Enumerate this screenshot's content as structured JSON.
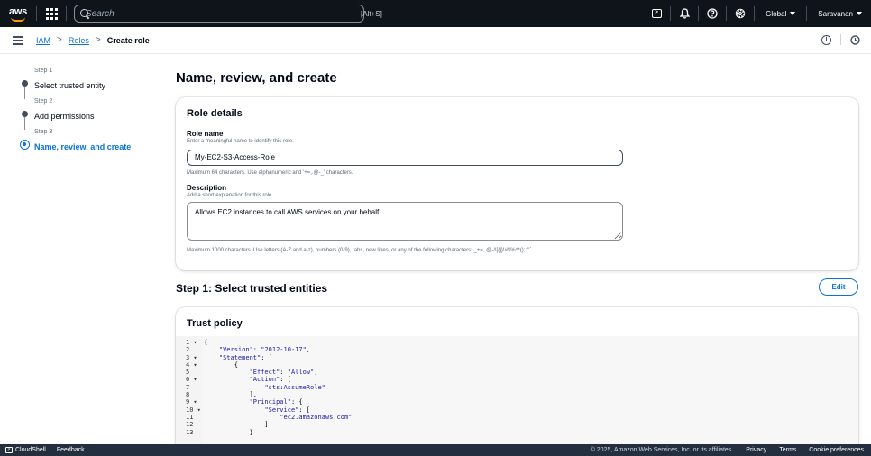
{
  "topbar": {
    "logo_text": "aws",
    "search_placeholder": "Search",
    "search_shortcut": "[Alt+S]",
    "region_label": "Global",
    "user_label": "Saravanan"
  },
  "breadcrumb": {
    "items": [
      "IAM",
      "Roles"
    ],
    "current": "Create role"
  },
  "steps": [
    {
      "step": "Step 1",
      "name": "Select trusted entity",
      "state": "complete"
    },
    {
      "step": "Step 2",
      "name": "Add permissions",
      "state": "complete"
    },
    {
      "step": "Step 3",
      "name": "Name, review, and create",
      "state": "active"
    }
  ],
  "main": {
    "title": "Name, review, and create",
    "role_details": {
      "header": "Role details",
      "role_name_label": "Role name",
      "role_name_description": "Enter a meaningful name to identify this role.",
      "role_name_value": "My-EC2-S3-Access-Role",
      "role_name_constraint": "Maximum 64 characters. Use alphanumeric and '+=,.@-_' characters.",
      "description_label": "Description",
      "description_description": "Add a short explanation for this role.",
      "description_value": "Allows EC2 instances to call AWS services on your behalf.",
      "description_constraint": "Maximum 1000 characters. Use letters (A-Z and a-z), numbers (0-9), tabs, new lines, or any of the following characters: _+=,.@-/\\[{]}!#$%^*();:\"'`"
    },
    "step1": {
      "title": "Step 1: Select trusted entities",
      "edit_label": "Edit",
      "trust_policy_header": "Trust policy",
      "line_numbers": [
        "1 ▾",
        "2",
        "3 ▾",
        "4 ▾",
        "5",
        "6 ▾",
        "7",
        "8",
        "9 ▾",
        "10 ▾",
        "11",
        "12",
        "13"
      ],
      "code_lines": [
        "{",
        "    \"Version\": \"2012-10-17\",",
        "    \"Statement\": [",
        "        {",
        "            \"Effect\": \"Allow\",",
        "            \"Action\": [",
        "                \"sts:AssumeRole\"",
        "            ],",
        "            \"Principal\": {",
        "                \"Service\": [",
        "                    \"ec2.amazonaws.com\"",
        "                ]",
        "            }"
      ]
    }
  },
  "footer": {
    "cloudshell": "CloudShell",
    "feedback": "Feedback",
    "copyright": "© 2025, Amazon Web Services, Inc. or its affiliates.",
    "privacy": "Privacy",
    "terms": "Terms",
    "cookie": "Cookie preferences"
  },
  "colors": {
    "topbar_bg": "#0f141a",
    "link": "#0972d3",
    "accent": "#ff9900",
    "footer_bg": "#232f3e"
  }
}
